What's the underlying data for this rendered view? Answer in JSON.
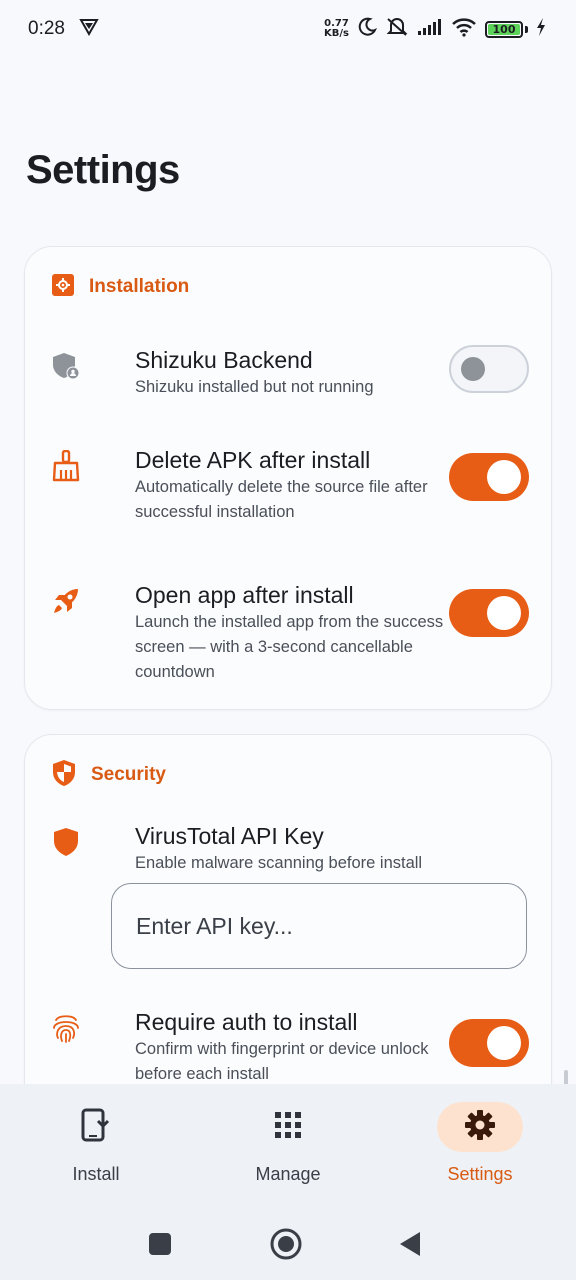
{
  "status_bar": {
    "time": "0:28",
    "net_speed_value": "0.77",
    "net_speed_unit": "KB/s",
    "battery": "100"
  },
  "page": {
    "title": "Settings"
  },
  "installation": {
    "title": "Installation",
    "shizuku": {
      "title": "Shizuku Backend",
      "subtitle": "Shizuku installed but not running",
      "enabled": false
    },
    "delete_apk": {
      "title": "Delete APK after install",
      "subtitle": "Automatically delete the source file after successful installation",
      "enabled": true
    },
    "open_app": {
      "title": "Open app after install",
      "subtitle": "Launch the installed app from the success screen — with a 3-second cancellable countdown",
      "enabled": true
    }
  },
  "security": {
    "title": "Security",
    "virustotal": {
      "title": "VirusTotal API Key",
      "subtitle": "Enable malware scanning before install",
      "placeholder": "Enter API key..."
    },
    "require_auth": {
      "title": "Require auth to install",
      "subtitle": "Confirm with fingerprint or device unlock before each install",
      "enabled": true
    }
  },
  "bottom_nav": {
    "install": "Install",
    "manage": "Manage",
    "settings": "Settings",
    "active": "settings"
  },
  "colors": {
    "accent": "#e85d15",
    "accent_text": "#d95a12",
    "active_pill": "#fde3cf"
  }
}
